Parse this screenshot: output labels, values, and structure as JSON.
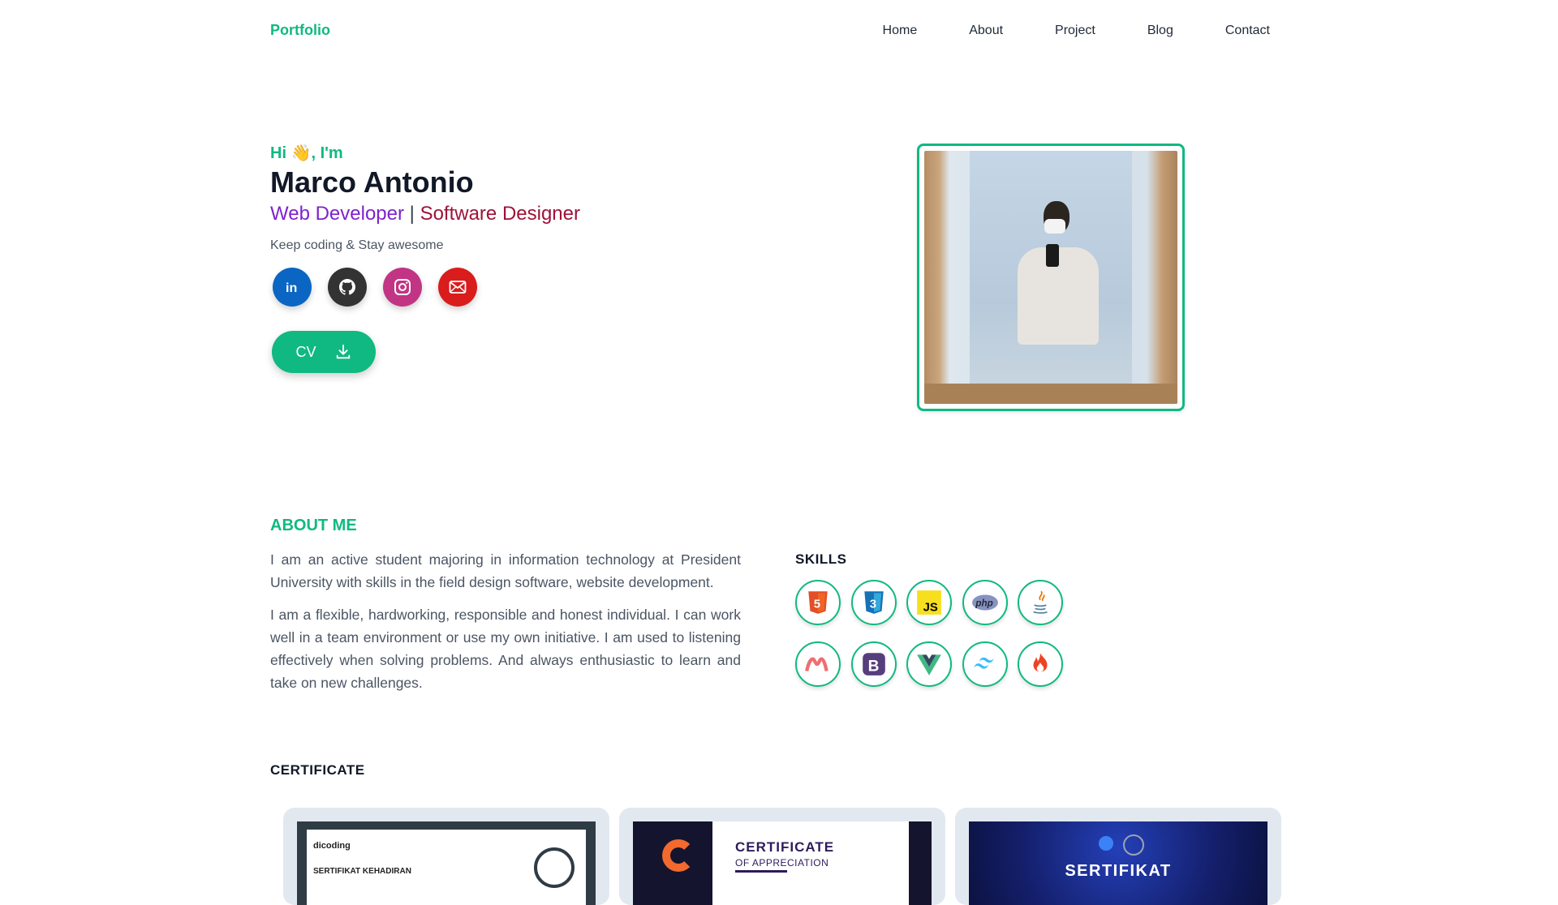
{
  "header": {
    "brand": "Portfolio",
    "nav": [
      "Home",
      "About",
      "Project",
      "Blog",
      "Contact"
    ]
  },
  "hero": {
    "greeting": "Hi 👋, I'm",
    "name": "Marco Antonio",
    "role_1": "Web Developer",
    "separator": "|",
    "role_2": "Software Designer",
    "tagline": "Keep coding & Stay awesome",
    "socials": [
      {
        "icon": "linkedin-icon",
        "color": "#0a66c2"
      },
      {
        "icon": "github-icon",
        "color": "#333333"
      },
      {
        "icon": "instagram-icon",
        "color": "#c13584"
      },
      {
        "icon": "mail-icon",
        "color": "#d91c1c"
      }
    ],
    "cv_label": "CV"
  },
  "about": {
    "title": "ABOUT ME",
    "paragraphs": [
      "I am an active student majoring in information technology at President University with skills in the field design software, website development.",
      "I am a flexible, hardworking, responsible and honest individual. I can work well in a team environment or use my own initiative. I am used to listening effectively when solving problems. And always enthusiastic to learn and take on new challenges."
    ]
  },
  "skills": {
    "title": "SKILLS",
    "items": [
      "html5-icon",
      "css3-icon",
      "javascript-icon",
      "php-icon",
      "java-icon",
      "materialize-icon",
      "bootstrap-icon",
      "vue-icon",
      "tailwind-icon",
      "codeigniter-icon"
    ]
  },
  "certificates": {
    "title": "CERTIFICATE",
    "cards": [
      {
        "brand": "dicoding",
        "heading": "SERTIFIKAT KEHADIRAN"
      },
      {
        "heading": "CERTIFICATE",
        "subheading": "OF APPRECIATION"
      },
      {
        "heading": "SERTIFIKAT"
      }
    ]
  },
  "colors": {
    "accent": "#10b981",
    "role_1": "#7e22ce",
    "role_2": "#9f1239"
  }
}
